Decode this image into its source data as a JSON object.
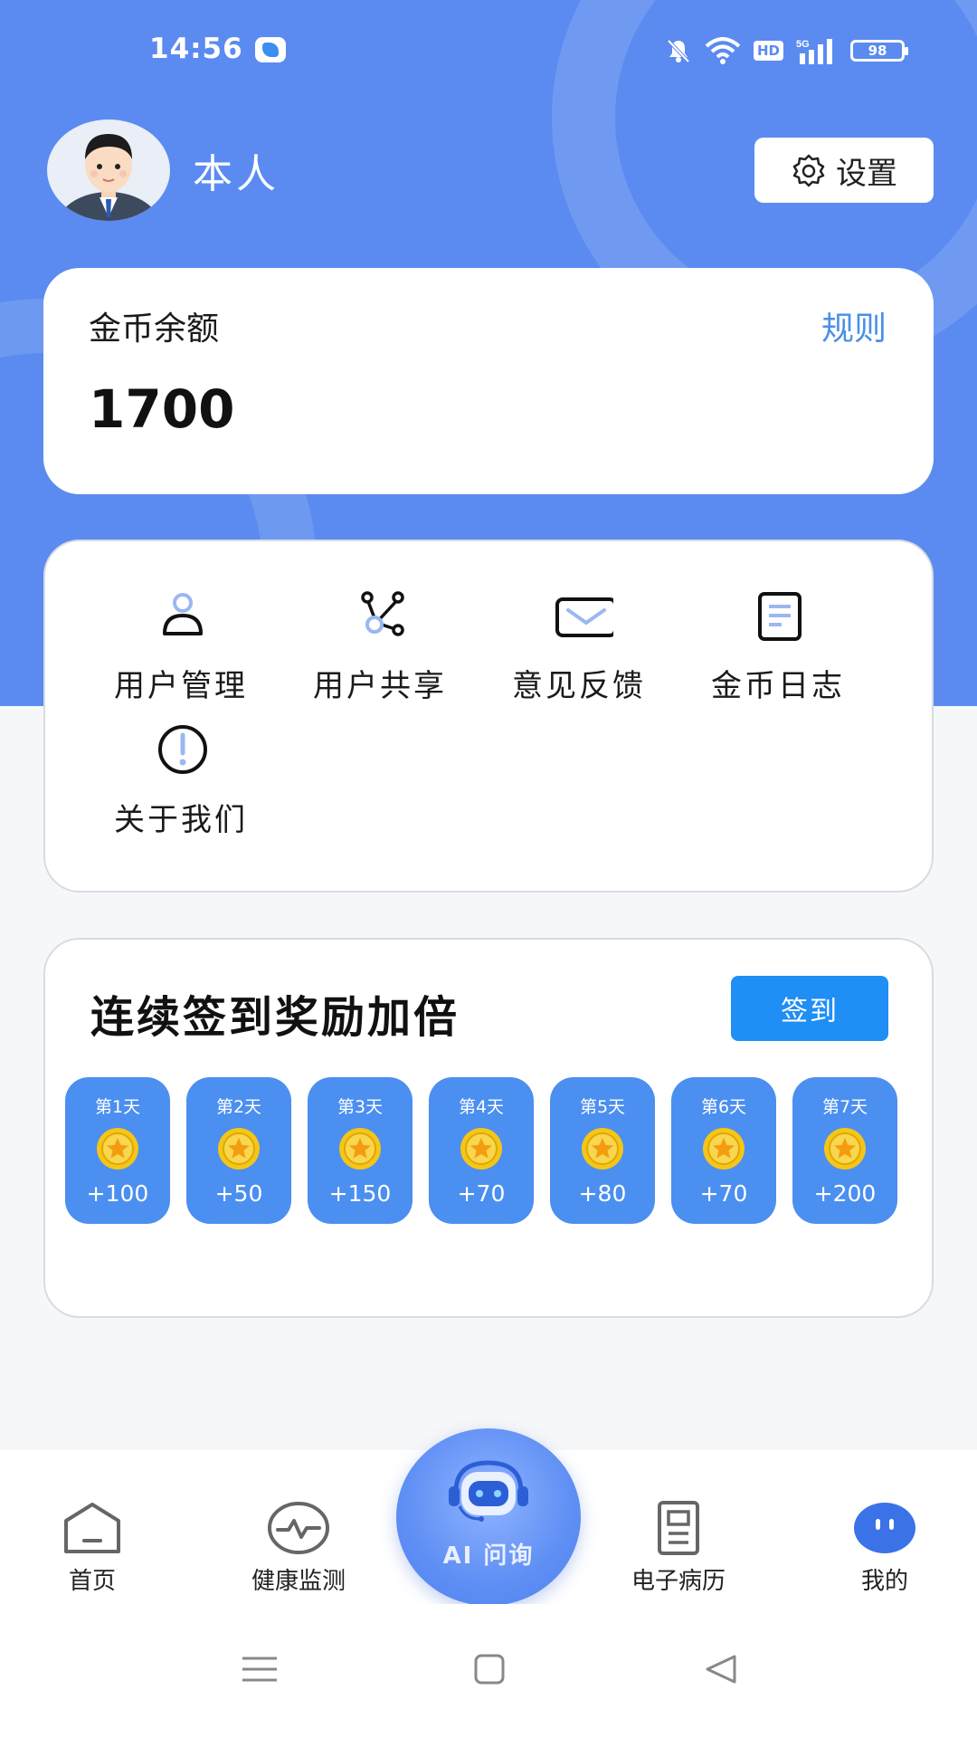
{
  "status_bar": {
    "time": "14:56",
    "network_badge": "HD",
    "network_type": "5G",
    "battery": "98",
    "icons": [
      "app-icon",
      "mute-icon",
      "wifi-icon",
      "hd-icon",
      "signal-icon",
      "battery-icon"
    ]
  },
  "profile": {
    "name": "本人",
    "settings_label": "设置",
    "settings_icon": "gear-icon"
  },
  "balance": {
    "label": "金币余额",
    "rules_label": "规则",
    "amount": "1700"
  },
  "menu": {
    "items": [
      {
        "label": "用户管理",
        "icon": "user-icon"
      },
      {
        "label": "用户共享",
        "icon": "share-icon"
      },
      {
        "label": "意见反馈",
        "icon": "mail-icon"
      },
      {
        "label": "金币日志",
        "icon": "document-icon"
      },
      {
        "label": "关于我们",
        "icon": "info-icon"
      }
    ]
  },
  "signin": {
    "title": "连续签到奖励加倍",
    "button_label": "签到",
    "days": [
      {
        "label": "第1天",
        "reward": "+100"
      },
      {
        "label": "第2天",
        "reward": "+50"
      },
      {
        "label": "第3天",
        "reward": "+150"
      },
      {
        "label": "第4天",
        "reward": "+70"
      },
      {
        "label": "第5天",
        "reward": "+80"
      },
      {
        "label": "第6天",
        "reward": "+70"
      },
      {
        "label": "第7天",
        "reward": "+200"
      }
    ]
  },
  "tabbar": {
    "tabs": [
      {
        "label": "首页",
        "icon": "home-icon"
      },
      {
        "label": "健康监测",
        "icon": "pulse-icon"
      },
      {
        "label": "电子病历",
        "icon": "record-icon"
      },
      {
        "label": "我的",
        "icon": "profile-face-icon"
      }
    ],
    "ai_label": "AI 问询",
    "active_tab": "我的"
  },
  "colors": {
    "primary": "#5b8bf0",
    "accent": "#1f8ef5",
    "link": "#4a8fe7",
    "card_day": "#4b8ff0",
    "coin": "#f5c518"
  }
}
